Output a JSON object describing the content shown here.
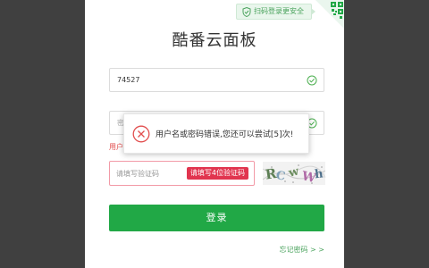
{
  "qr_tip": {
    "text": "扫码登录更安全",
    "icon": "shield-check-icon"
  },
  "title": "酷番云面板",
  "username": {
    "value": "74527",
    "icon": "check-circle-icon"
  },
  "password": {
    "placeholder": "密",
    "icon": "check-circle-icon"
  },
  "error_label": "用户",
  "captcha": {
    "placeholder": "请填写验证码",
    "hint": "请填写4位验证码"
  },
  "login_button": "登录",
  "forgot_link": "忘记密码 > >",
  "toast": {
    "message": "用户名或密码错误,您还可以尝试[5]次!",
    "icon": "error-x-icon"
  },
  "colors": {
    "accent": "#21a846",
    "error": "#e24e4e",
    "hint_bg": "#e1354f",
    "backdrop": "#404040"
  }
}
